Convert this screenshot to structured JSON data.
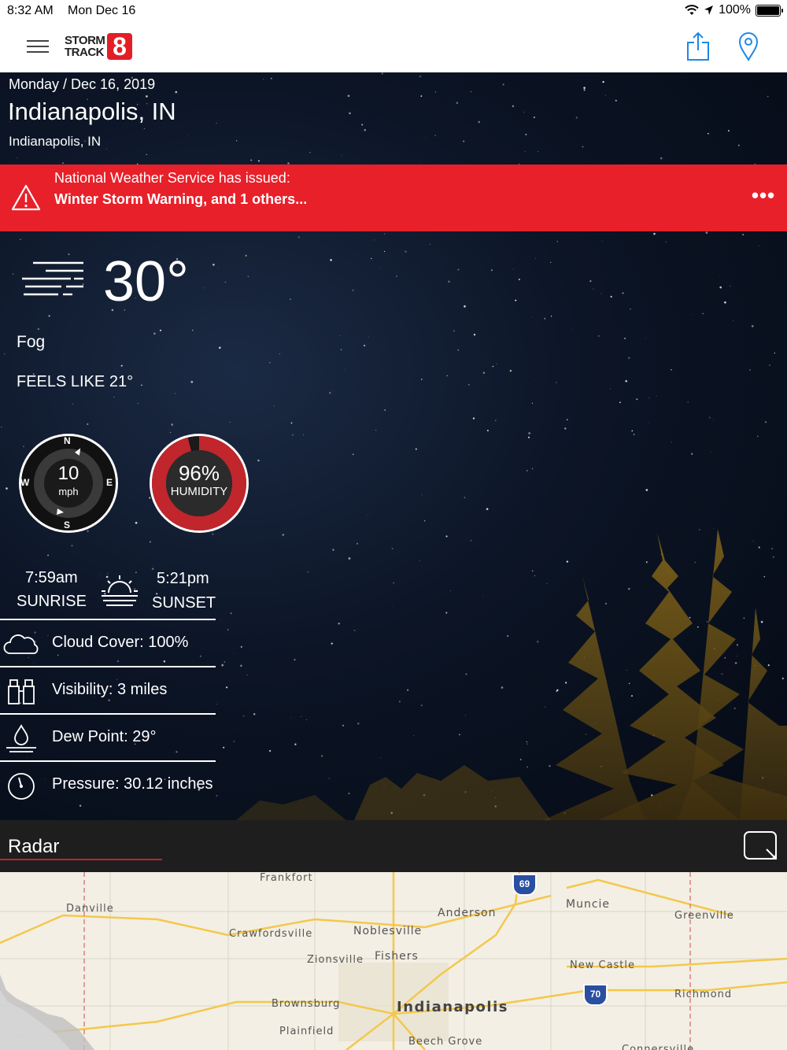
{
  "status_bar": {
    "time": "8:32 AM",
    "date": "Mon Dec 16",
    "battery": "100%"
  },
  "nav": {
    "logo_line1": "STORM",
    "logo_line2": "TRACK",
    "logo_number": "8"
  },
  "location": {
    "date": "Monday / Dec 16, 2019",
    "city": "Indianapolis, IN",
    "sub": "Indianapolis, IN"
  },
  "alert": {
    "line1": "National Weather Service has issued:",
    "line2": "Winter Storm Warning, and 1 others...",
    "more": "•••"
  },
  "current": {
    "temp": "30°",
    "condition": "Fog",
    "feels_like": "FEELS LIKE 21°",
    "icon": "fog-icon"
  },
  "wind": {
    "speed": "10",
    "unit": "mph",
    "n": "N",
    "s": "S",
    "e": "E",
    "w": "W"
  },
  "humidity": {
    "value": "96%",
    "label": "HUMIDITY",
    "fraction": 0.96
  },
  "sun": {
    "sunrise_time": "7:59am",
    "sunrise_label": "SUNRISE",
    "sunset_time": "5:21pm",
    "sunset_label": "SUNSET"
  },
  "details": [
    {
      "icon": "cloud-icon",
      "text": "Cloud Cover: 100%"
    },
    {
      "icon": "binoculars-icon",
      "text": "Visibility: 3 miles"
    },
    {
      "icon": "droplet-icon",
      "text": "Dew Point: 29°"
    },
    {
      "icon": "gauge-icon",
      "text": "Pressure: 30.12 inches"
    }
  ],
  "radar": {
    "title": "Radar",
    "labels": {
      "frankfort": "Frankfort",
      "danville": "Danville",
      "crawfordsville": "Crawfordsville",
      "anderson": "Anderson",
      "muncie": "Muncie",
      "greenville": "Greenville",
      "noblesville": "Noblesville",
      "zionsville": "Zionsville",
      "fishers": "Fishers",
      "new_castle": "New Castle",
      "brownsburg": "Brownsburg",
      "indianapolis": "Indianapolis",
      "richmond": "Richmond",
      "plainfield": "Plainfield",
      "beech_grove": "Beech Grove",
      "connersville": "Connersville"
    },
    "shields": {
      "i69": "69",
      "i70": "70"
    }
  },
  "colors": {
    "alert_red": "#e8202a",
    "accent_blue": "#1e88e5",
    "humidity_ring": "#c0262c"
  }
}
